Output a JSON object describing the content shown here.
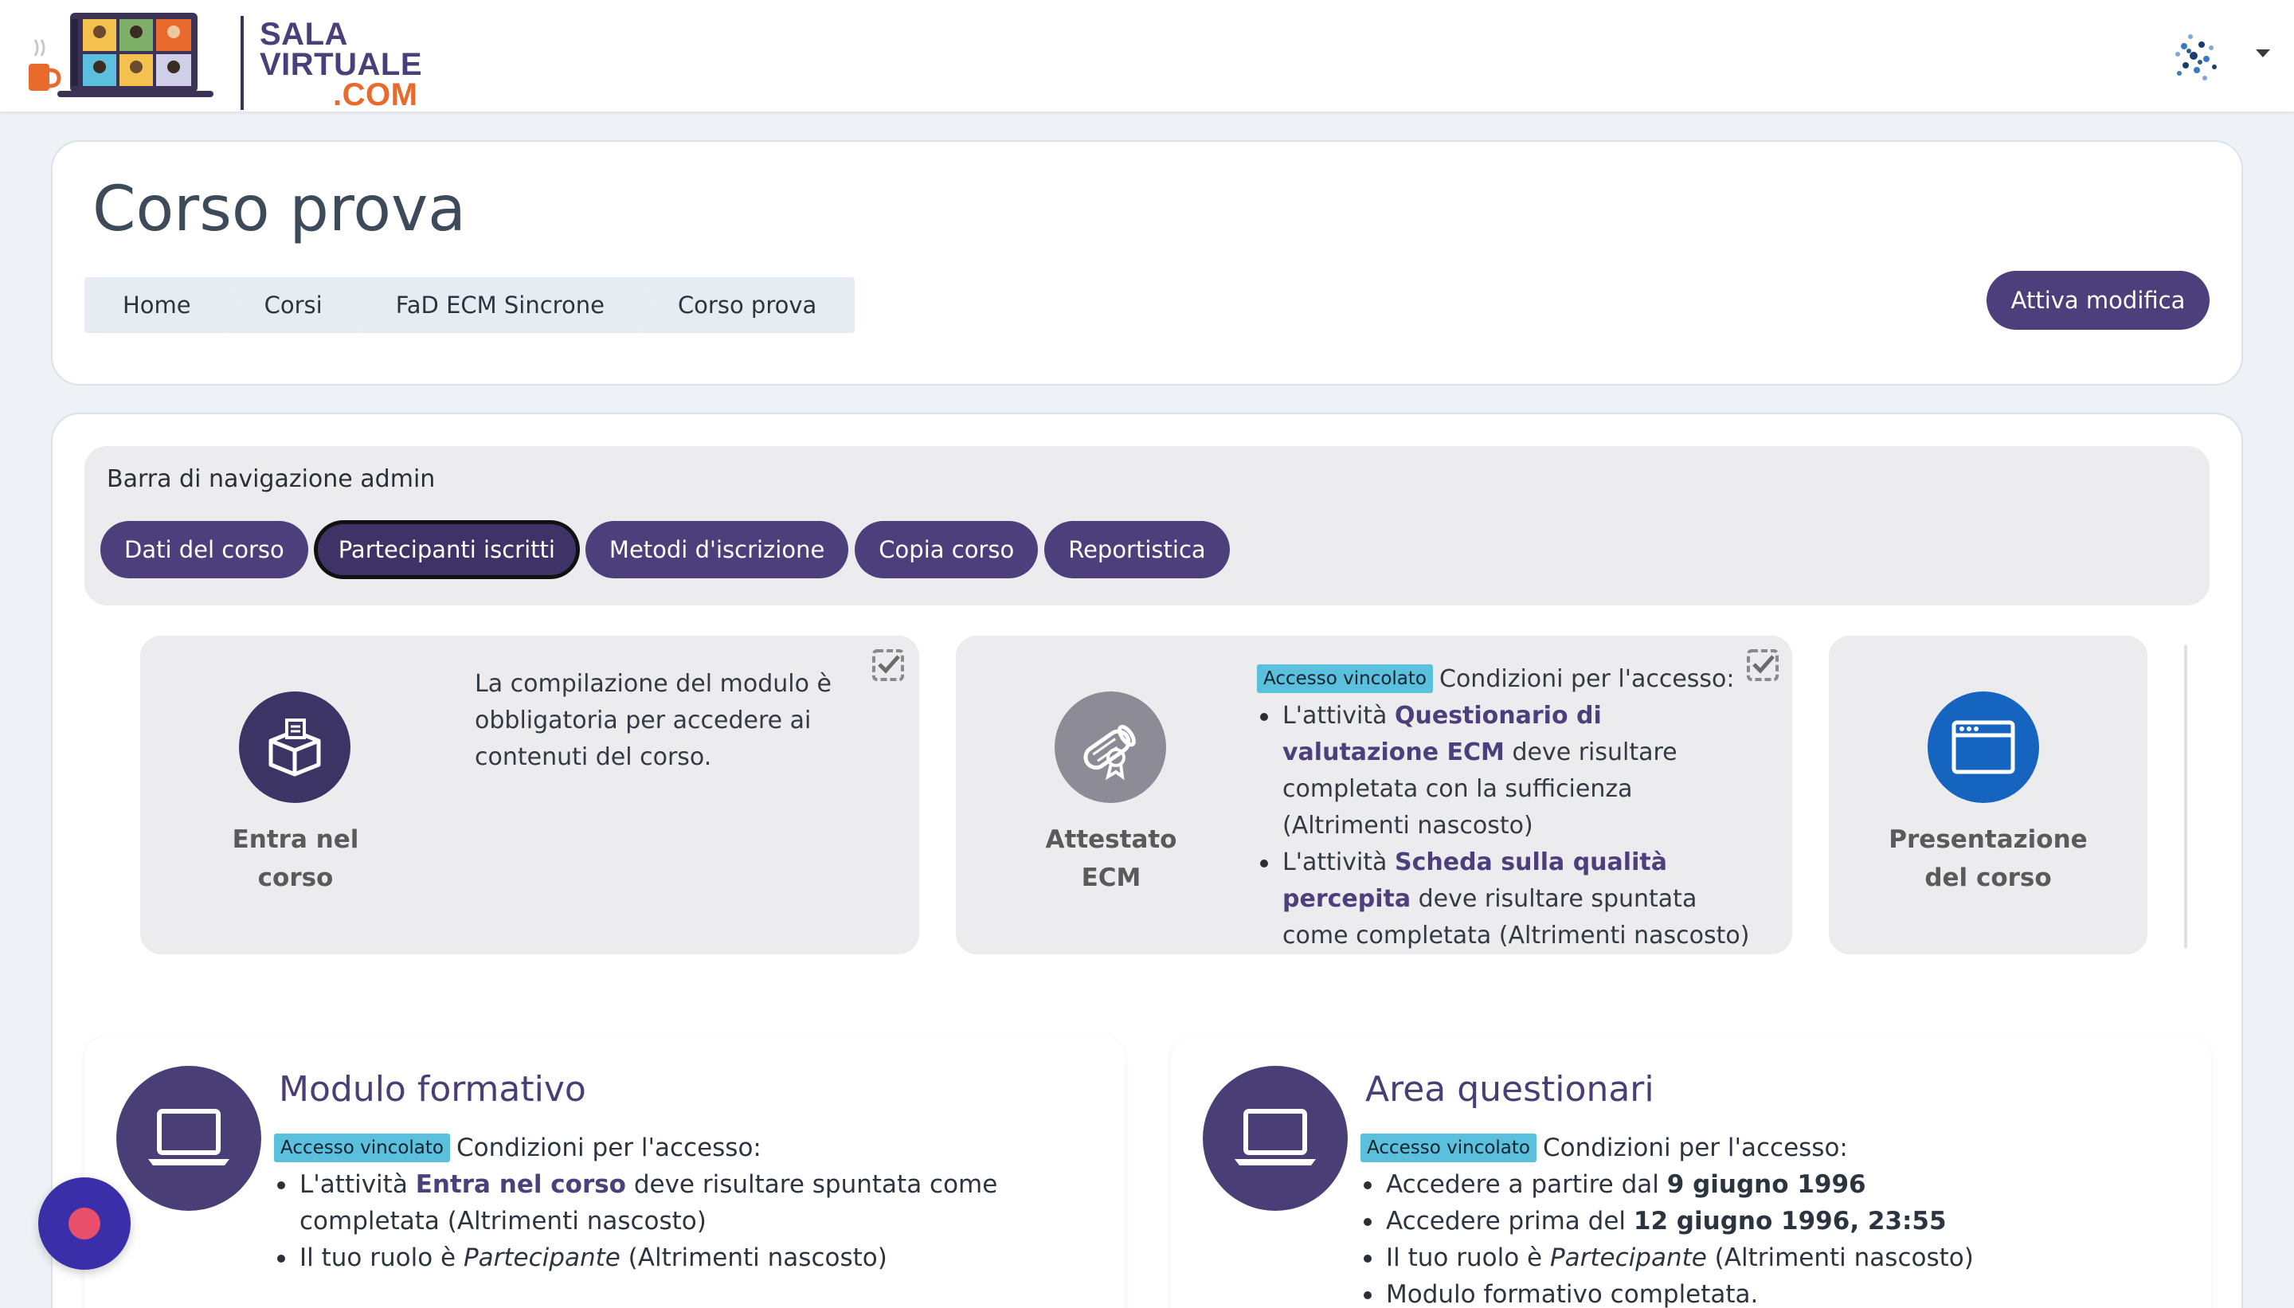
{
  "header": {
    "logo": {
      "line1": "SALA",
      "line2": "VIRTUALE",
      "line3": ".COM"
    },
    "user_menu_icon": "user-avatar-icon",
    "caret_icon": "caret-down-icon"
  },
  "page": {
    "title": "Corso prova",
    "breadcrumb": [
      "Home",
      "Corsi",
      "FaD ECM Sincrone",
      "Corso prova"
    ],
    "edit_button": "Attiva modifica"
  },
  "admin_nav": {
    "title": "Barra di navigazione admin",
    "buttons": [
      "Dati del corso",
      "Partecipanti iscritti",
      "Metodi d'iscrizione",
      "Copia corso",
      "Reportistica"
    ],
    "active_index": 1
  },
  "tiles": [
    {
      "label_line1": "Entra nel",
      "label_line2": "corso",
      "icon": "box-icon",
      "icon_color": "#3d3466",
      "description": "La compilazione del modulo è obbligatoria per accedere ai contenuti del corso."
    },
    {
      "label_line1": "Attestato",
      "label_line2": "ECM",
      "icon": "certificate-icon",
      "icon_color": "#8c8b96",
      "badge": "Accesso vincolato",
      "conditions_title": "Condizioni per l'accesso:",
      "c1_pre": "L'attività ",
      "c1_link": "Questionario di valutazione ECM",
      "c1_post": " deve risultare completata con la sufficienza (Altrimenti nascosto)",
      "c2_pre": "L'attività ",
      "c2_link": "Scheda sulla qualità percepita",
      "c2_post": " deve risultare spuntata come completata (Altrimenti nascosto)"
    },
    {
      "label_line1": "Presentazione",
      "label_line2": "del corso",
      "icon": "browser-window-icon",
      "icon_color": "#1565c0"
    }
  ],
  "sections": [
    {
      "title": "Modulo formativo",
      "icon": "laptop-icon",
      "badge": "Accesso vincolato",
      "conditions_title": "Condizioni per l'accesso:",
      "c1_pre": "L'attività ",
      "c1_link": "Entra nel corso",
      "c1_post": " deve risultare spuntata come completata (Altrimenti nascosto)",
      "c2_pre": "Il tuo ruolo è ",
      "c2_it": "Partecipante",
      "c2_post": " (Altrimenti nascosto)"
    },
    {
      "title": "Area questionari",
      "icon": "laptop-icon",
      "badge": "Accesso vincolato",
      "conditions_title": "Condizioni per l'accesso:",
      "c1_pre": "Accedere a partire dal ",
      "c1_strong": "9 giugno 1996",
      "c2_pre": "Accedere prima del ",
      "c2_strong": "12 giugno 1996, 23:55",
      "c3_pre": "Il tuo ruolo è ",
      "c3_it": "Partecipante",
      "c3_post": " (Altrimenti nascosto)",
      "c4": "Modulo formativo completata."
    }
  ],
  "colors": {
    "brand": "#4c3f7c",
    "badge": "#5bc0de",
    "fab": "#3a2fa8",
    "fab_dot": "#e8506a"
  }
}
